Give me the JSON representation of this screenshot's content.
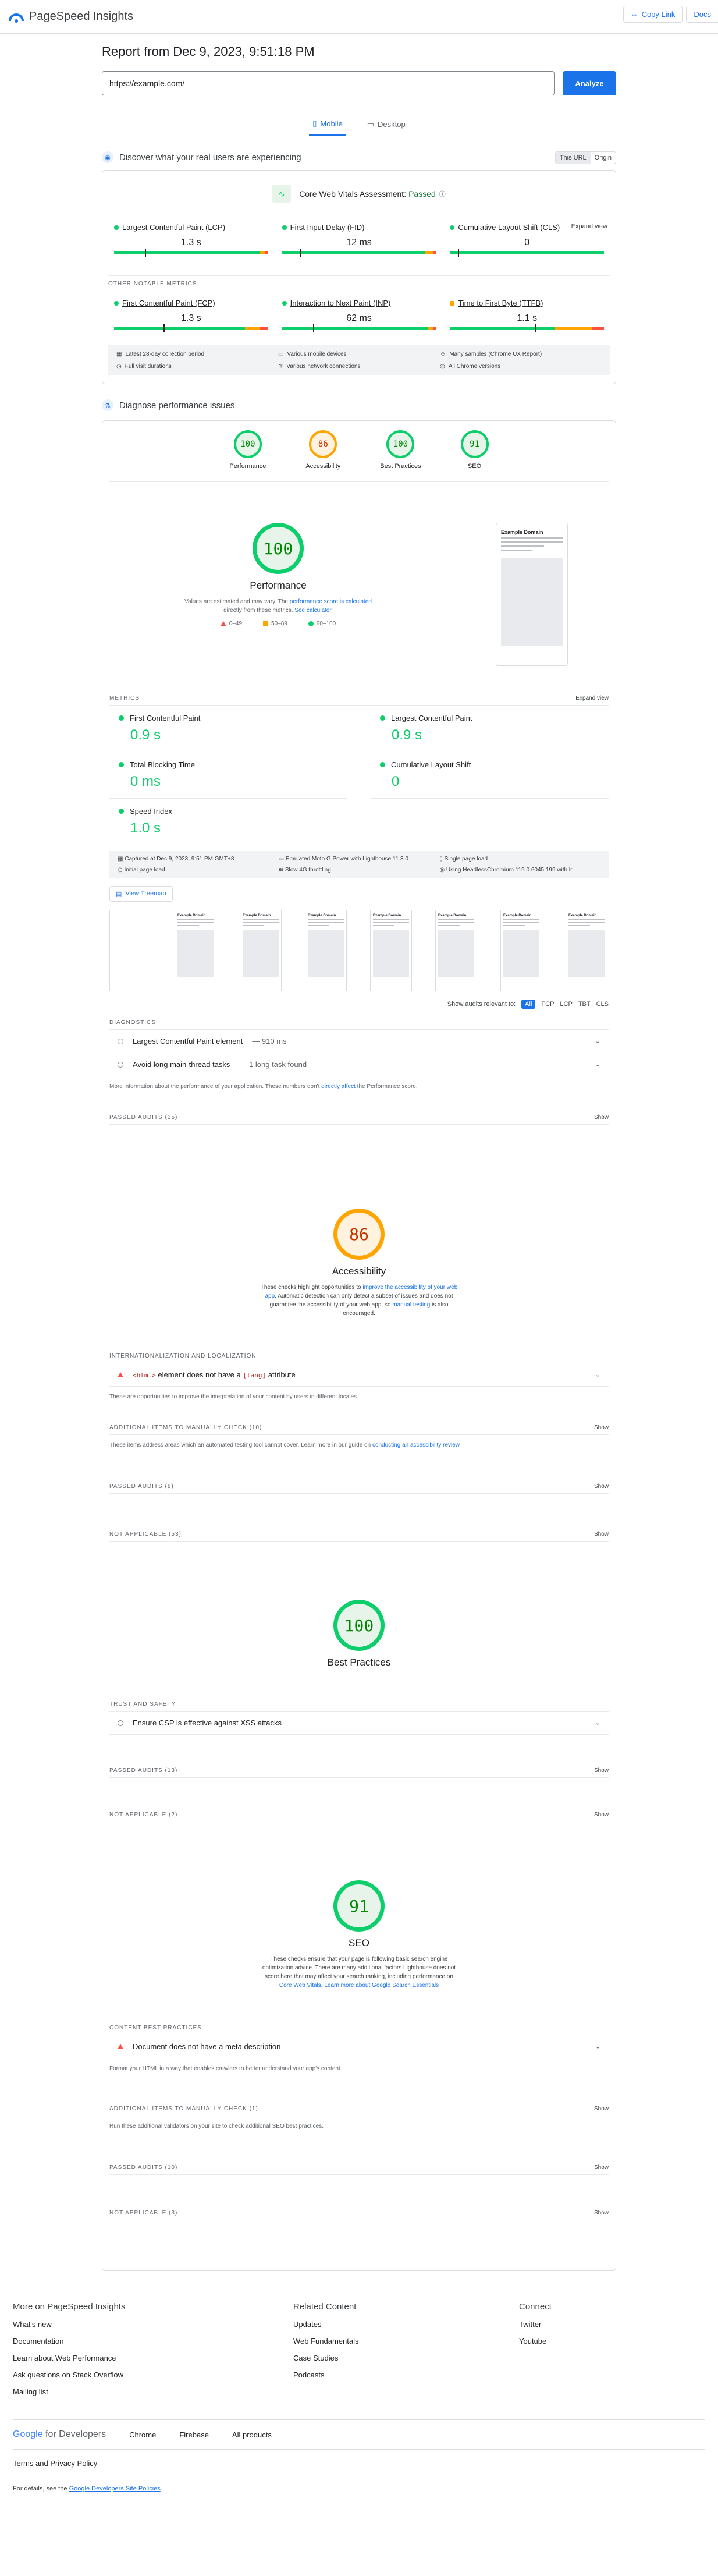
{
  "header": {
    "app_name": "PageSpeed Insights",
    "copy_link": "Copy Link",
    "docs": "Docs"
  },
  "report": {
    "title": "Report from Dec 9, 2023, 9:51:18 PM",
    "url": "https://example.com/",
    "analyze": "Analyze",
    "tabs": [
      "Mobile",
      "Desktop"
    ]
  },
  "field": {
    "heading": "Discover what your real users are experiencing",
    "toggle": [
      "This URL",
      "Origin"
    ],
    "assessment_label": "Core Web Vitals Assessment:",
    "assessment_value": "Passed",
    "expand": "Expand view",
    "core": [
      {
        "name": "Largest Contentful Paint (LCP)",
        "value": "1.3 s",
        "dist": [
          95,
          3,
          2
        ],
        "marker": 0.2
      },
      {
        "name": "First Input Delay (FID)",
        "value": "12 ms",
        "dist": [
          93,
          5,
          2
        ],
        "marker": 0.12
      },
      {
        "name": "Cumulative Layout Shift (CLS)",
        "value": "0",
        "dist": [
          100,
          0,
          0
        ],
        "marker": 0.05
      }
    ],
    "other_title": "OTHER NOTABLE METRICS",
    "other": [
      {
        "name": "First Contentful Paint (FCP)",
        "value": "1.3 s",
        "dist": [
          85,
          10,
          5
        ],
        "marker": 0.32,
        "status": "good"
      },
      {
        "name": "Interaction to Next Paint (INP)",
        "value": "62 ms",
        "dist": [
          95,
          3,
          2
        ],
        "marker": 0.2,
        "status": "good"
      },
      {
        "name": "Time to First Byte (TTFB)",
        "value": "1.1 s",
        "dist": [
          68,
          24,
          8
        ],
        "marker": 0.55,
        "status": "average"
      }
    ],
    "info": [
      "Latest 28-day collection period",
      "Various mobile devices",
      "Many samples (Chrome UX Report)",
      "Full visit durations",
      "Various network connections",
      "All Chrome versions"
    ]
  },
  "diagnose": {
    "heading": "Diagnose performance issues",
    "gauges": [
      {
        "label": "Performance",
        "score": "100"
      },
      {
        "label": "Accessibility",
        "score": "86"
      },
      {
        "label": "Best Practices",
        "score": "100"
      },
      {
        "label": "SEO",
        "score": "91"
      }
    ],
    "perf": {
      "score": "100",
      "label": "Performance",
      "desc_a": "Values are estimated and may vary. The",
      "desc_link": "performance score is calculated",
      "desc_b": "directly from these metrics.",
      "desc_link2": "See calculator.",
      "legend": [
        "0–49",
        "50–89",
        "90–100"
      ],
      "shot_title": "Example Domain"
    },
    "metrics_title": "METRICS",
    "metrics_expand": "Expand view",
    "lab": [
      {
        "name": "First Contentful Paint",
        "value": "0.9 s"
      },
      {
        "name": "Largest Contentful Paint",
        "value": "0.9 s"
      },
      {
        "name": "Total Blocking Time",
        "value": "0 ms"
      },
      {
        "name": "Cumulative Layout Shift",
        "value": "0"
      },
      {
        "name": "Speed Index",
        "value": "1.0 s"
      }
    ],
    "lab_info": [
      "Captured at Dec 9, 2023, 9:51 PM GMT+8",
      "Emulated Moto G Power with Lighthouse 11.3.0",
      "Single page load",
      "Initial page load",
      "Slow 4G throttling",
      "Using HeadlessChromium 119.0.6045.199 with lr"
    ],
    "treemap": "View Treemap",
    "relevant": "Show audits relevant to:",
    "relevant_pills": [
      "All",
      "FCP",
      "LCP",
      "TBT",
      "CLS"
    ],
    "diagnostics_title": "DIAGNOSTICS",
    "diagnostics": [
      {
        "name": "Largest Contentful Paint element",
        "detail": "— 910 ms"
      },
      {
        "name": "Avoid long main-thread tasks",
        "detail": "— 1 long task found"
      }
    ],
    "diag_note_a": "More information about the performance of your application. These numbers don't",
    "diag_note_link": "directly affect",
    "diag_note_b": "the Performance score.",
    "passed": "PASSED AUDITS (35)",
    "show": "Show"
  },
  "accessibility": {
    "score": "86",
    "label": "Accessibility",
    "desc_a": "These checks highlight opportunities to",
    "desc_link": "improve the accessibility of your web app",
    "desc_b": ". Automatic detection can only detect a subset of issues and does not guarantee the accessibility of your web app, so",
    "desc_link2": "manual testing",
    "desc_c": "is also encouraged.",
    "i18n_title": "INTERNATIONALIZATION AND LOCALIZATION",
    "i18n_audit_code1": "<html>",
    "i18n_audit_mid": "element does not have a",
    "i18n_audit_code2": "[lang]",
    "i18n_audit_end": "attribute",
    "i18n_note": "These are opportunities to improve the interpretation of your content by users in different locales.",
    "manual_title": "ADDITIONAL ITEMS TO MANUALLY CHECK (10)",
    "manual_note": "These items address areas which an automated testing tool cannot cover. Learn more in our guide on",
    "manual_link": "conducting an accessibility review",
    "passed": "PASSED AUDITS (8)",
    "na": "NOT APPLICABLE (53)",
    "show": "Show"
  },
  "best_practices": {
    "score": "100",
    "label": "Best Practices",
    "trust_title": "TRUST AND SAFETY",
    "audit": "Ensure CSP is effective against XSS attacks",
    "passed": "PASSED AUDITS (13)",
    "na": "NOT APPLICABLE (2)",
    "show": "Show"
  },
  "seo": {
    "score": "91",
    "label": "SEO",
    "desc_a": "These checks ensure that your page is following basic search engine optimization advice. There are many additional factors Lighthouse does not score here that may affect your search ranking, including performance on",
    "desc_link": "Core Web Vitals",
    "desc_b": ".",
    "desc_link2": "Learn more about Google Search Essentials",
    "content_title": "CONTENT BEST PRACTICES",
    "audit": "Document does not have a meta description",
    "content_note": "Format your HTML in a way that enables crawlers to better understand your app's content.",
    "manual_title": "ADDITIONAL ITEMS TO MANUALLY CHECK (1)",
    "manual_note": "Run these additional validators on your site to check additional SEO best practices.",
    "passed": "PASSED AUDITS (10)",
    "na": "NOT APPLICABLE (3)",
    "show": "Show"
  },
  "footer": {
    "col1_title": "More on PageSpeed Insights",
    "col1": [
      "What's new",
      "Documentation",
      "Learn about Web Performance",
      "Ask questions on Stack Overflow",
      "Mailing list"
    ],
    "col2_title": "Related Content",
    "col2": [
      "Updates",
      "Web Fundamentals",
      "Case Studies",
      "Podcasts"
    ],
    "col3_title": "Connect",
    "col3": [
      "Twitter",
      "Youtube"
    ],
    "gdev_google": "Google",
    "gdev_for": "for Developers",
    "gdev_links": [
      "Chrome",
      "Firebase",
      "All products"
    ],
    "legal": "Terms and Privacy Policy",
    "details_a": "For details, see the",
    "details_link": "Google Developers Site Policies",
    "details_b": "."
  }
}
